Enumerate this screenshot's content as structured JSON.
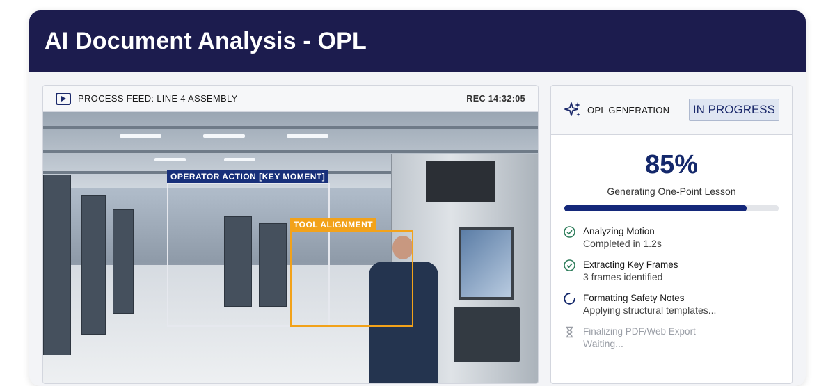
{
  "header": {
    "title": "AI Document Analysis - OPL"
  },
  "feed": {
    "title": "PROCESS FEED: LINE 4 ASSEMBLY",
    "rec": "REC 14:32:05",
    "annotations": {
      "operator": "OPERATOR ACTION [KEY MOMENT]",
      "tool": "TOOL ALIGNMENT"
    }
  },
  "panel": {
    "title": "OPL GENERATION",
    "status": "IN PROGRESS",
    "percent_label": "85%",
    "progress": 0.85,
    "subtitle": "Generating One-Point Lesson",
    "steps": [
      {
        "title": "Analyzing Motion",
        "detail": "Completed in 1.2s",
        "state": "done",
        "icon": "check-circle-icon"
      },
      {
        "title": "Extracting Key Frames",
        "detail": "3 frames identified",
        "state": "done",
        "icon": "check-circle-icon"
      },
      {
        "title": "Formatting Safety Notes",
        "detail": "Applying structural templates...",
        "state": "active",
        "icon": "spinner-icon"
      },
      {
        "title": "Finalizing PDF/Web Export",
        "detail": "Waiting...",
        "state": "waiting",
        "icon": "hourglass-icon"
      }
    ]
  },
  "colors": {
    "navy": "#1c1c4e",
    "accent": "#14286b",
    "done": "#2e7d5b",
    "annotation_orange": "#f2a21a"
  }
}
